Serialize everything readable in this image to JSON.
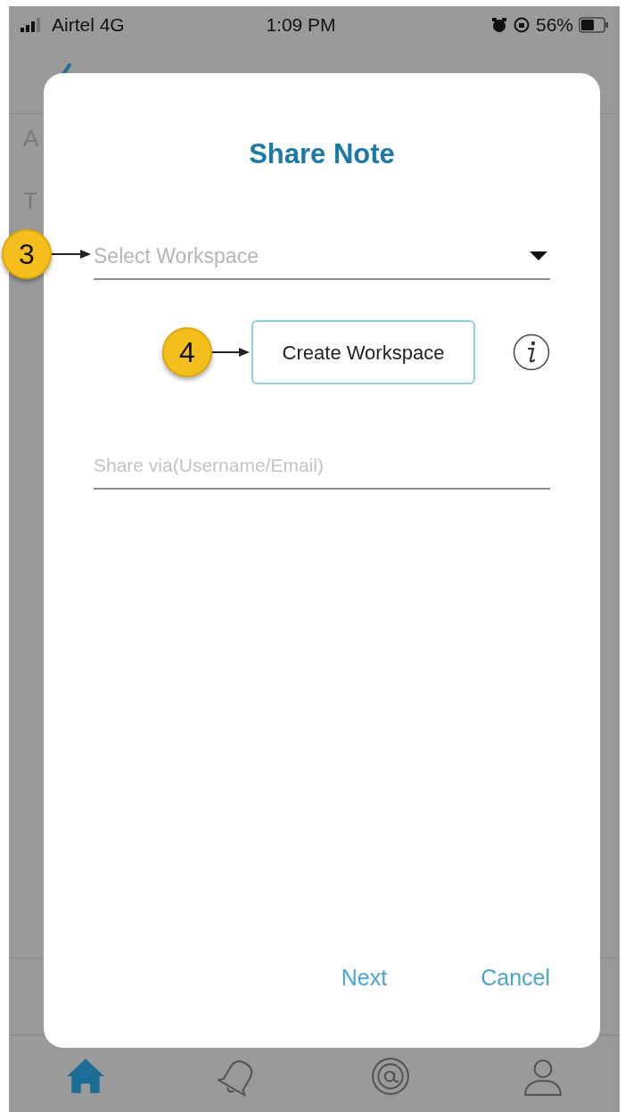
{
  "status_bar": {
    "carrier": "Airtel 4G",
    "time": "1:09 PM",
    "battery": "56%"
  },
  "background": {
    "labels": [
      "A",
      "T"
    ]
  },
  "dialog": {
    "title": "Share Note",
    "workspace_select": {
      "placeholder": "Select Workspace"
    },
    "create_button": "Create Workspace",
    "share_field": {
      "placeholder": "Share via(Username/Email)"
    },
    "actions": [
      "Next",
      "Cancel"
    ]
  },
  "callouts": [
    {
      "number": "3"
    },
    {
      "number": "4"
    }
  ],
  "tab_bar": [
    {
      "kind": "home",
      "selected": true
    },
    {
      "kind": "bell",
      "selected": false
    },
    {
      "kind": "at",
      "selected": false
    },
    {
      "kind": "user",
      "selected": false
    }
  ]
}
